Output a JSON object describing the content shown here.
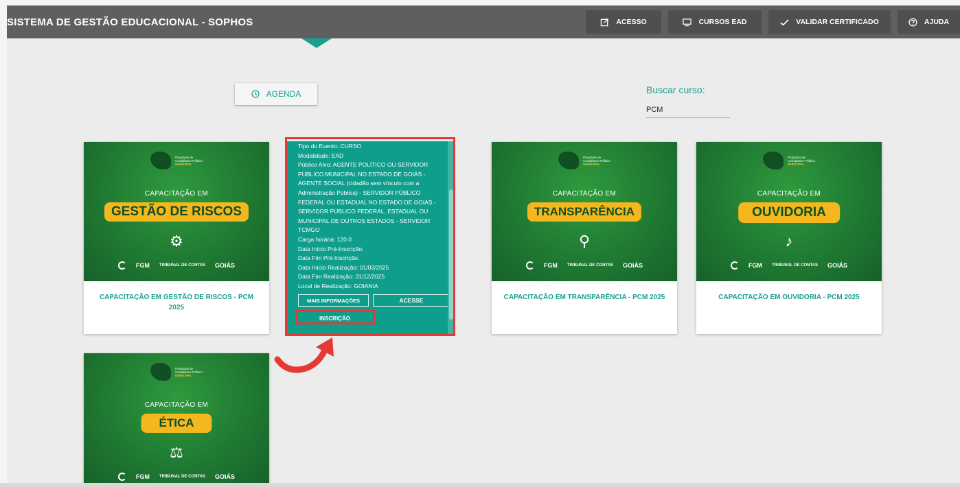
{
  "header": {
    "title": "SISTEMA DE GESTÃO EDUCACIONAL - SOPHOS",
    "nav": [
      {
        "label": "ACESSO",
        "icon": "external-link-icon"
      },
      {
        "label": "CURSOS EAD",
        "icon": "monitor-icon"
      },
      {
        "label": "VALIDAR CERTIFICADO",
        "icon": "check-icon"
      },
      {
        "label": "AJUDA",
        "icon": "help-circle-icon"
      }
    ]
  },
  "agenda": {
    "label": "AGENDA",
    "icon": "clock-icon"
  },
  "search": {
    "label": "Buscar curso:",
    "value": "PCM"
  },
  "program": {
    "line1": "Programa de",
    "line2": "Compliance Público",
    "line3": "MUNICIPAL"
  },
  "card_image": {
    "prefix": "CAPACITAÇÃO EM",
    "logos": [
      "FGM",
      "TRIBUNAL DE CONTAS",
      "GOIÁS"
    ]
  },
  "cards": [
    {
      "topic": "GESTÃO DE RISCOS",
      "caption": "CAPACITAÇÃO EM GESTÃO DE RISCOS - PCM 2025",
      "icon": "gears-icon"
    },
    {
      "topic": "TRANSPARÊNCIA",
      "caption": "CAPACITAÇÃO EM TRANSPARÊNCIA - PCM 2025",
      "icon": "magnifier-eye-icon"
    },
    {
      "topic": "OUVIDORIA",
      "caption": "CAPACITAÇÃO EM OUVIDORIA - PCM 2025",
      "icon": "ear-icon"
    },
    {
      "topic": "ÉTICA",
      "icon": "scales-icon"
    }
  ],
  "overlay": {
    "info": [
      "Tipo do Evento: CURSO",
      "Modalidade: EAD",
      "Público Alvo: AGENTE POLÍTICO OU SERVIDOR PÚBLICO MUNICIPAL NO ESTADO DE GOIÁS - AGENTE SOCIAL (cidadão sem vínculo com a Administração Pública) - SERVIDOR PÚBLICO FEDERAL OU ESTADUAL NO ESTADO DE GOIÁS - SERVIDOR PÚBLICO FEDERAL, ESTADUAL OU MUNICIPAL DE OUTROS ESTADOS - SERVIDOR TCMGO",
      "Carga horária: 120.0",
      "Data Início Pré-Inscrição:",
      "Data Fim Pré-Inscrição:",
      "Data Início Realização: 01/03/2025",
      "Data Fim Realização: 31/12/2025",
      "Local de Realização: GOIANIA"
    ],
    "more_label": "MAIS INFORMAÇÕES",
    "access_label": "ACESSE",
    "signup_label": "INSCRIÇÃO"
  }
}
